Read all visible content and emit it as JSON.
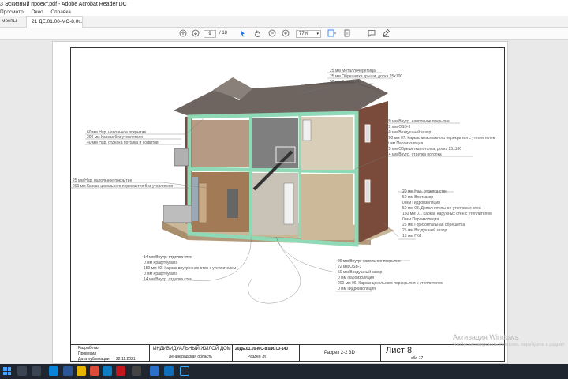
{
  "window": {
    "title": "3 Эскизный проект.pdf - Adobe Acrobat Reader DC"
  },
  "menu": {
    "items": [
      "Просмотр",
      "Окно",
      "Справка"
    ]
  },
  "tabs": {
    "tools_label": "менты",
    "doc_label": "21 ДЕ.01.00-МС-8.0...",
    "close_glyph": "×"
  },
  "toolbar": {
    "page_current": "9",
    "page_total": "/ 18",
    "zoom": "77%"
  },
  "drawing": {
    "roof_callout": [
      "25 мм  Металлочерепица",
      "25 мм  Обрешетка крыши, доска 25х100",
      "50 мм  Вентзазор"
    ],
    "upper_left_callout": [
      "60 мм  Нар. напольное покрытие",
      "200 мм  Каркас без утеплителя",
      "40 мм  Нар. отделка потолка и софитов"
    ],
    "upper_right_callout": [
      "20 мм  Внутр. напольное покрытие",
      "22 мм  OSB-3",
      "50 мм  Воздушный зазор",
      "200 мм  07. Каркас межэтажного перекрытия с утеплителем",
      "0 мм  Пароизоляция",
      "25 мм  Обрешетка потолка, доска 25х100",
      "14 мм  Внутр. отделка потолка"
    ],
    "mid_left_callout": [
      "25 мм  Нар. напольное покрытие",
      "200 мм  Каркас цокольного перекрытия без утеплителя"
    ],
    "right_wall_callout": [
      "20 мм  Нар. отделка стен",
      "50 мм  Вентзазор",
      "0 мм  Гидроизоляция",
      "50 мм  03. Дополнительное утепление стен",
      "150 мм  01. Каркас наружных стен с утеплителем",
      "0 мм  Пароизоляция",
      "25 мм  Горизонтальная обрешетка",
      "25 мм  Воздушный зазор",
      "13 мм  ГКЛ"
    ],
    "lower_left_callout": [
      "14 мм  Внутр. отделка стен",
      "0 мм  Крафтбумага",
      "150 мм  02. Каркас внутренних стен с утеплителем",
      "0 мм  Крафтбумага",
      "14 мм  Внутр. отделка стен"
    ],
    "lower_right_callout": [
      "20 мм  Внутр. напольное покрытие",
      "22 мм  OSB-3",
      "50 мм  Воздушный зазор",
      "0 мм  Пароизоляция",
      "200 мм  06. Каркас цокольного перекрытия с утеплителем",
      "0 мм  Гидроизоляция"
    ]
  },
  "stamp": {
    "row1_label": "Разработал",
    "row2_label": "Проверил",
    "row3_label": "Дата публикации:",
    "date": "22.11.2021",
    "project_title": "ИНДИВИДУАЛЬНЫЙ ЖИЛОЙ ДОМ",
    "region": "Ленинградская область",
    "code": "20ДЕ.01.00-МС-8.0/ИЛ.0-140",
    "section": "Раздел ЭП",
    "sheet_title": "Разрез 2-2 3D",
    "sheet_label": "Лист 8",
    "sheet_sub": "обл 17"
  },
  "watermark": {
    "line1": "Активация Windows",
    "line2": "Чтобы активировать Windows, перейдите в раздел"
  },
  "colors": {
    "wall_green": "#8fd9b6",
    "facade_brown": "#7a4b3a",
    "roof_gray": "#6f6560",
    "accent_blue": "#1473e6",
    "taskbar": "#1f2630"
  }
}
